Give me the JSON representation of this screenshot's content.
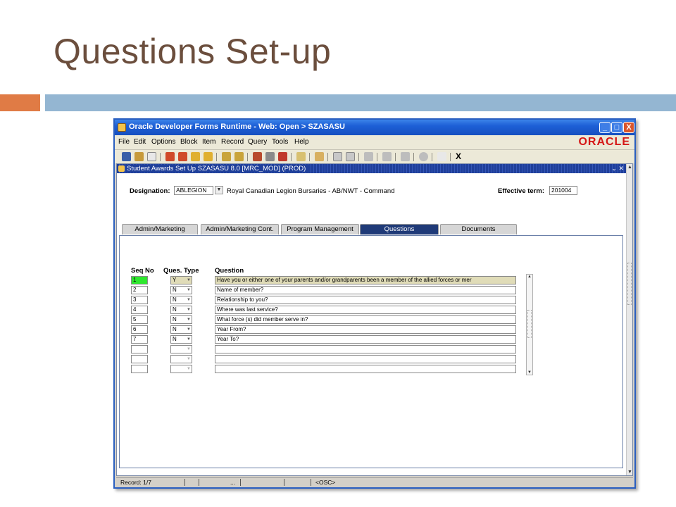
{
  "slide": {
    "title": "Questions Set-up"
  },
  "window": {
    "title": "Oracle Developer Forms Runtime - Web:  Open > SZASASU",
    "controls": [
      "_",
      "□",
      "X"
    ],
    "menu": [
      "File",
      "Edit",
      "Options",
      "Block",
      "Item",
      "Record",
      "Query",
      "Tools",
      "Help"
    ],
    "logo": "ORACLE",
    "toolbar_close": "X"
  },
  "form": {
    "title": "Student Awards Set Up  SZASASU  8.0  [MRC_MOD]  (PROD)",
    "title_controls": "⌄ ✕",
    "designation_label": "Designation:",
    "designation_value": "ABLEGION",
    "designation_desc": "Royal Canadian Legion Bursaries - AB/NWT - Command",
    "effective_term_label": "Effective term:",
    "effective_term_value": "201004",
    "tabs": [
      {
        "label": "Admin/Marketing",
        "active": false
      },
      {
        "label": "Admin/Marketing Cont.",
        "active": false
      },
      {
        "label": "Program Management",
        "active": false
      },
      {
        "label": "Questions",
        "active": true
      },
      {
        "label": "Documents",
        "active": false
      }
    ],
    "grid": {
      "headers": {
        "seq": "Seq No",
        "type": "Ques. Type",
        "question": "Question"
      },
      "rows": [
        {
          "seq": "1",
          "type": "Y",
          "question": "Have you or either one of your parents and/or grandparents been a member of the allied forces or mer"
        },
        {
          "seq": "2",
          "type": "N",
          "question": "Name of member?"
        },
        {
          "seq": "3",
          "type": "N",
          "question": "Relationship to you?"
        },
        {
          "seq": "4",
          "type": "N",
          "question": "Where was last service?"
        },
        {
          "seq": "5",
          "type": "N",
          "question": "What force (s) did member serve in?"
        },
        {
          "seq": "6",
          "type": "N",
          "question": "Year From?"
        },
        {
          "seq": "7",
          "type": "N",
          "question": "Year To?"
        },
        {
          "seq": "",
          "type": "",
          "question": ""
        },
        {
          "seq": "",
          "type": "",
          "question": ""
        },
        {
          "seq": "",
          "type": "",
          "question": ""
        }
      ]
    }
  },
  "status": {
    "record": "Record: 1/7",
    "ellipsis": "...",
    "mode": "<OSC>"
  },
  "colors": {
    "title_text": "#6b4e3d",
    "accent_orange": "#e07b45",
    "accent_blue": "#94b6d2",
    "active_tab": "#1f3a78",
    "current_record": "#2ee82e"
  }
}
